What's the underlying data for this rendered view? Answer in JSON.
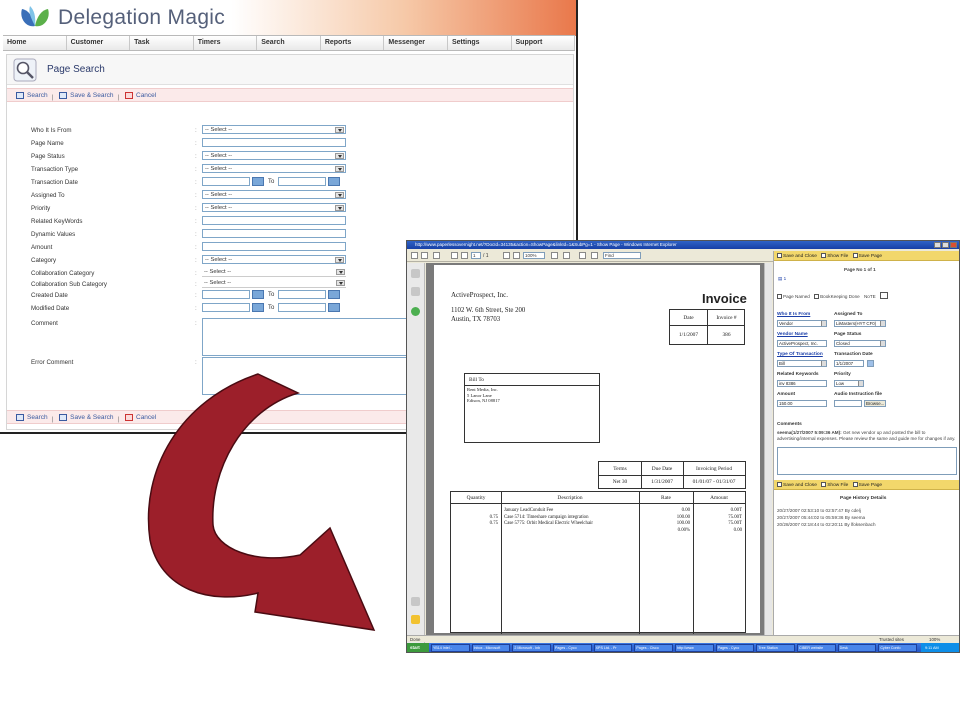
{
  "colors": {
    "header_gradient_end": "#e9774a",
    "nav_text": "#333333",
    "link_blue": "#3a5aa0",
    "arrow_red": "#9c1f2a",
    "pdf_gray": "#7a7a7a",
    "form_bar_yellow": "#f2d76b"
  },
  "app": {
    "title": "Delegation Magic",
    "logo_icon": "butterfly-logo",
    "nav": [
      "Home",
      "Customer",
      "Task",
      "Timers",
      "Search",
      "Reports",
      "Messenger",
      "Settings",
      "Support"
    ]
  },
  "page_search": {
    "icon": "magnifier-icon",
    "title": "Page Search",
    "actions": {
      "search": "Search",
      "save_search": "Save & Search",
      "cancel": "Cancel"
    },
    "colon": ":",
    "fields": [
      {
        "label": "Who It Is From",
        "type": "select",
        "value": "-- Select --"
      },
      {
        "label": "Page Name",
        "type": "input",
        "value": ""
      },
      {
        "label": "Page Status",
        "type": "select",
        "value": "-- Select --"
      },
      {
        "label": "Transaction Type",
        "type": "select",
        "value": "-- Select --"
      },
      {
        "label": "Transaction Date",
        "type": "daterange",
        "to": "To"
      },
      {
        "label": "Assigned To",
        "type": "select",
        "value": "-- Select --"
      },
      {
        "label": "Priority",
        "type": "select",
        "value": "-- Select --"
      },
      {
        "label": "Related KeyWords",
        "type": "input",
        "value": ""
      },
      {
        "label": "Dynamic Values",
        "type": "input",
        "value": ""
      },
      {
        "label": "Amount",
        "type": "input",
        "value": ""
      },
      {
        "label": "Category",
        "type": "select",
        "value": "-- Select --"
      },
      {
        "label": "Collaboration Category",
        "type": "plainselect",
        "value": "-- Select --"
      },
      {
        "label": "Collaboration Sub Category",
        "type": "plainselect",
        "value": "-- Select --"
      },
      {
        "label": "Created Date",
        "type": "daterange",
        "to": "To"
      },
      {
        "label": "Modified Date",
        "type": "daterange",
        "to": "To"
      },
      {
        "label": "Comment",
        "type": "textarea",
        "value": ""
      },
      {
        "label": "Error Comment",
        "type": "textarea",
        "value": ""
      }
    ]
  },
  "ie": {
    "title": "http://www.paperlessovernight.net/?DocId=34135&action=ShowPage&linkId=1&SubPg=1 - Show Page - Windows Internet Explorer",
    "toolbar": {
      "page_num": "1",
      "page_total": "/ 1",
      "zoom": "100%",
      "find": "Find"
    },
    "status": "Done",
    "status_zone": "Trusted sites",
    "status_zoom": "100%",
    "taskbar": {
      "start": "start",
      "items": [
        "YB14 Intel -",
        "Inbox - Microsoft",
        "2 Microsoft - Inb",
        "Pages - Cyco",
        "XPS Ltd. - Pr",
        "Pages - Cisco",
        "http://www",
        "Pages - Cyco",
        "Tree Station",
        "CIBER website",
        "Desk",
        "Cyber Confo"
      ],
      "clock": "9:11 AM"
    }
  },
  "invoice": {
    "from_name": "ActiveProspect, Inc.",
    "from_address1": "1102 W. 6th Street, Ste 200",
    "from_address2": "Austin, TX 78703",
    "heading": "Invoice",
    "date_label": "Date",
    "invno_label": "Invoice #",
    "date": "1/1/2007",
    "invno": "386",
    "billto_label": "Bill To",
    "billto1": "Rent Media, Inc.",
    "billto2": "5 Lanor Lane",
    "billto3": "Edison, NJ 08817",
    "terms_label": "Terms",
    "due_label": "Due Date",
    "period_label": "Invoicing Period",
    "terms": "Net 30",
    "due": "1/31/2007",
    "period": "01/01/07 - 01/31/07",
    "col_qty": "Quantity",
    "col_desc": "Description",
    "col_rate": "Rate",
    "col_amount": "Amount",
    "lines": [
      {
        "qty": "",
        "desc": "January LeadConduit Fee",
        "rate": "0.00",
        "amount": "0.00T"
      },
      {
        "qty": "0.75",
        "desc": "Case 5714: Timeshare campaign integration",
        "rate": "100.00",
        "amount": "75.00T"
      },
      {
        "qty": "0.75",
        "desc": "Case 5775: Orbit Medical Electric Wheelchair",
        "rate": "100.00",
        "amount": "75.00T"
      },
      {
        "qty": "",
        "desc": "",
        "rate": "0.00%",
        "amount": "0.00"
      }
    ]
  },
  "side_form": {
    "save_close": "Save and Close",
    "show_file": "Show File",
    "save_page": "Save Page",
    "page_no": "Page No 1 of 1",
    "page_named": "Page Named",
    "bookkeeping_done": "BookKeeping Done",
    "note": "NoTE",
    "who_label": "Who It Is From",
    "who_value": "Vendor",
    "assigned_label": "Assigned To",
    "assigned_value": "LiMasters(HYT CF0)",
    "vendor_label": "Vendor Name",
    "vendor_value": "ActiveProspect, Inc.",
    "status_label": "Page Status",
    "status_value": "Closed",
    "txtype_label": "Type Of Transaction",
    "txtype_value": "Bill",
    "txdate_label": "Transaction Date",
    "txdate_value": "1/1/2007",
    "keywords_label": "Related Keywords",
    "keywords_value": "inv 8386",
    "priority_label": "Priority",
    "priority_value": "Low",
    "amount_label": "Amount",
    "amount_value": "150.00",
    "audio_label": "Audio Instruction file",
    "browse": "Browse...",
    "comments_label": "Comments",
    "comment_author": "seema(1/27/2007 5:09:36 AM):",
    "comment_text": "Get new vendor up and posted the bill to advertising/internal expenses. Please review the same and guide me for changes if any.",
    "history_title": "Page History Details",
    "history": [
      "20/27/2007 02:53:10 to 02:57:47 By cdelj",
      "20/27/2007 05:44:02 to 05:59:36 By seema",
      "20/28/2007 02:18:44 to 02:20:11 By lfoksenbach"
    ]
  }
}
